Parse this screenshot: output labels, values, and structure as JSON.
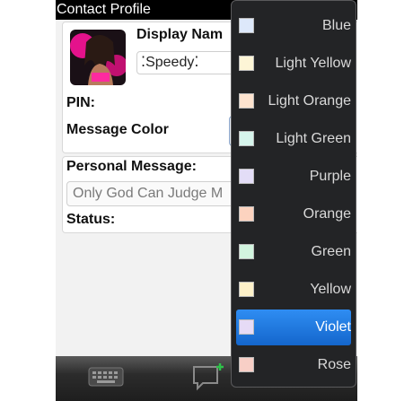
{
  "window": {
    "title": "Contact Profile"
  },
  "profile": {
    "display_name_label": "Display Nam",
    "display_name_value": "⁚Speedy⁚",
    "pin_label": "PIN:",
    "message_color_label": "Message Color",
    "personal_message_label": "Personal Message:",
    "personal_message_value": "Only God Can Judge M",
    "status_label": "Status:"
  },
  "color_menu": {
    "selected": "Violet",
    "items": [
      {
        "label": "Blue",
        "swatch": "#dde8fa"
      },
      {
        "label": "Light Yellow",
        "swatch": "#fdf5d6"
      },
      {
        "label": "Light Orange",
        "swatch": "#fde3cf"
      },
      {
        "label": "Light Green",
        "swatch": "#d6f5ec"
      },
      {
        "label": "Purple",
        "swatch": "#e3ddf7"
      },
      {
        "label": "Orange",
        "swatch": "#fcd3bf"
      },
      {
        "label": "Green",
        "swatch": "#d2f5df"
      },
      {
        "label": "Yellow",
        "swatch": "#fdf1c9"
      },
      {
        "label": "Violet",
        "swatch": "#e6dbf6"
      },
      {
        "label": "Rose",
        "swatch": "#f8cfc6"
      }
    ]
  },
  "bottom_bar": {
    "icons": [
      "keyboard-icon",
      "chat-add-icon"
    ]
  },
  "colors": {
    "selection": "#1f7be0",
    "menu_bg": "#232426"
  }
}
